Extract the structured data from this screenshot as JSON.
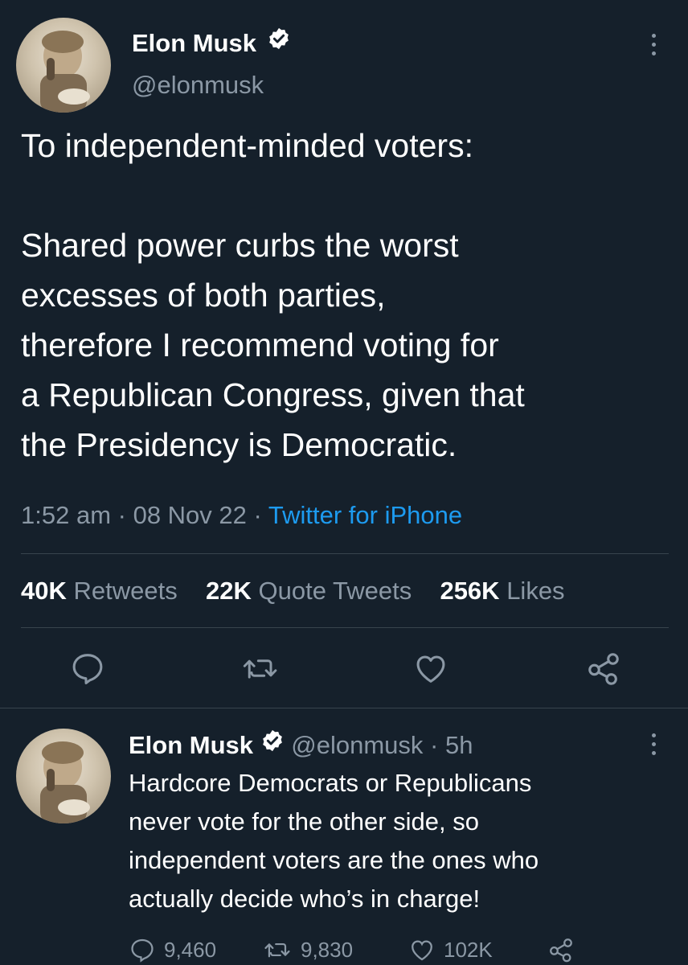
{
  "main_tweet": {
    "author_name": "Elon Musk",
    "handle": "@elonmusk",
    "line1": "To independent-minded voters:",
    "body_lines": [
      "Shared power curbs the worst",
      "excesses of both parties,",
      "therefore I recommend voting for",
      "a Republican Congress, given that",
      "the Presidency is Democratic."
    ],
    "time": "1:52 am",
    "sep1": " · ",
    "date": "08 Nov 22",
    "sep2": " · ",
    "source": "Twitter for iPhone",
    "retweets_count": "40K",
    "retweets_label": "Retweets",
    "quotes_count": "22K",
    "quotes_label": "Quote Tweets",
    "likes_count": "256K",
    "likes_label": "Likes"
  },
  "reply_tweet": {
    "author_name": "Elon Musk",
    "handle": "@elonmusk",
    "dot": " · ",
    "age": "5h",
    "body_lines": [
      "Hardcore Democrats or Republicans",
      "never vote for the other side, so",
      "independent voters are the ones who",
      "actually decide who’s in charge!"
    ],
    "replies": "9,460",
    "retweets": "9,830",
    "likes": "102K"
  },
  "colors": {
    "background": "#15202b",
    "text": "#ffffff",
    "muted": "#8b98a5",
    "link": "#1d9bf0",
    "divider": "#38444d"
  },
  "icons": {
    "reply": "reply-icon",
    "retweet": "retweet-icon",
    "like": "heart-icon",
    "share": "share-icon",
    "verified": "verified-badge-icon",
    "more": "more-options-icon"
  }
}
